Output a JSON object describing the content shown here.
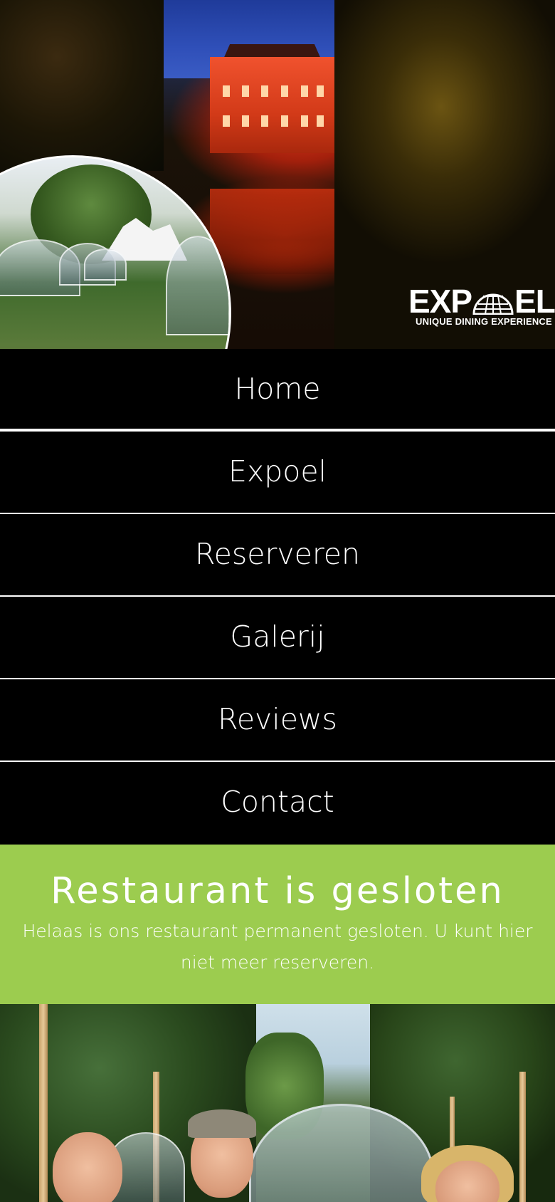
{
  "hero": {
    "logo_text_left": "EXP",
    "logo_text_right": "EL",
    "logo_tagline": "UNIQUE DINING EXPERIENCE",
    "logo_icon": "dome-icon"
  },
  "nav": {
    "items": [
      {
        "label": "Home"
      },
      {
        "label": "Expoel"
      },
      {
        "label": "Reserveren"
      },
      {
        "label": "Galerij"
      },
      {
        "label": "Reviews"
      },
      {
        "label": "Contact"
      }
    ]
  },
  "notice": {
    "title": "Restaurant is gesloten",
    "message": "Helaas is ons restaurant permanent gesloten. U kunt hier niet meer reserveren."
  },
  "colors": {
    "nav_background": "#000000",
    "notice_background": "#9ccc4f",
    "text": "#ffffff"
  }
}
